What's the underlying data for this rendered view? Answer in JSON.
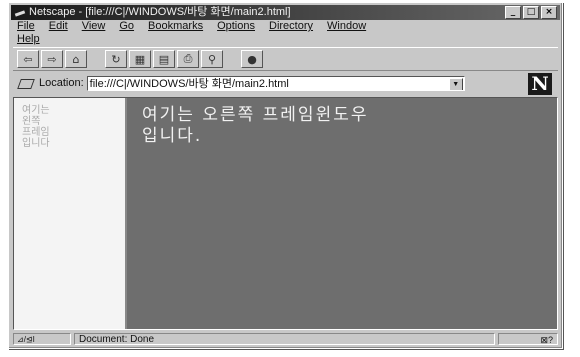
{
  "window": {
    "title": "Netscape - [file:///C|/WINDOWS/바탕 화면/main2.html]",
    "minimize_label": "_",
    "maximize_label": "□",
    "close_label": "×"
  },
  "menu": {
    "items": [
      "File",
      "Edit",
      "View",
      "Go",
      "Bookmarks",
      "Options",
      "Directory",
      "Window",
      "Help"
    ]
  },
  "toolbar": {
    "icons": [
      "back-icon",
      "forward-icon",
      "home-icon",
      "reload-icon",
      "images-icon",
      "open-icon",
      "print-icon",
      "find-icon",
      "stop-icon"
    ]
  },
  "location": {
    "label": "Location:",
    "value": "file:///C|/WINDOWS/바탕 화면/main2.html",
    "logo": "N"
  },
  "frames": {
    "left_text": [
      "여기는",
      "왼쪽",
      "프레임",
      "입니다"
    ],
    "right_text_line1": "여기는 오른쪽 프레임윈도우",
    "right_text_line2": "입니다."
  },
  "status": {
    "left": "⊿/⊴ⅼ",
    "text": "Document: Done",
    "right": "⊠?"
  }
}
